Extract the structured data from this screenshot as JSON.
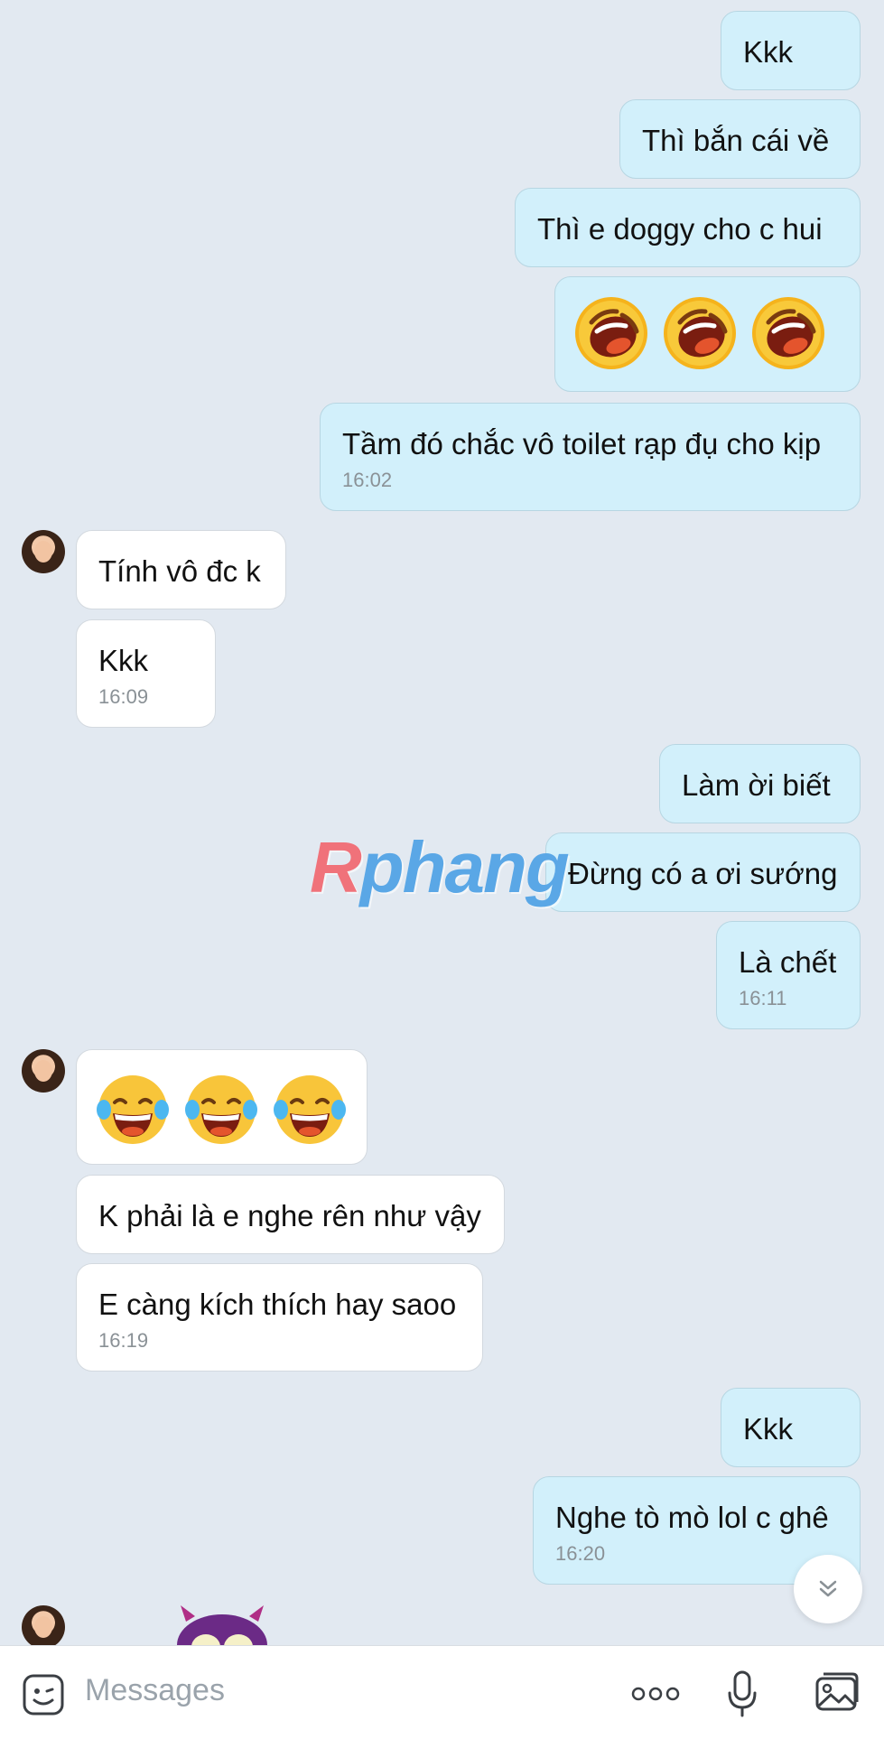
{
  "messages": [
    {
      "dir": "out",
      "text": "Kkk"
    },
    {
      "dir": "out",
      "text": "Thì bắn cái về"
    },
    {
      "dir": "out",
      "text": "Thì e doggy cho c hui"
    },
    {
      "dir": "out",
      "emoji": "laughing-face-icon x3"
    },
    {
      "dir": "out",
      "text": "Tầm đó chắc vô toilet rạp đụ cho kịp",
      "time": "16:02"
    },
    {
      "dir": "in",
      "text": "Tính vô đc k"
    },
    {
      "dir": "in",
      "text": "Kkk",
      "time": "16:09"
    },
    {
      "dir": "out",
      "text": "Làm ời biết"
    },
    {
      "dir": "out",
      "text": "Đừng có a ơi sướng"
    },
    {
      "dir": "out",
      "text": "Là chết",
      "time": "16:11"
    },
    {
      "dir": "in",
      "emoji": "tears-of-joy-icon x3"
    },
    {
      "dir": "in",
      "text": "K phải là e nghe rên như vậy"
    },
    {
      "dir": "in",
      "text": "E càng kích thích hay saoo",
      "time": "16:19"
    },
    {
      "dir": "out",
      "text": "Kkk"
    },
    {
      "dir": "out",
      "text": "Nghe tò mò lol c ghê",
      "time": "16:20"
    }
  ],
  "watermark": "Rphang",
  "input": {
    "placeholder": "Messages"
  },
  "icons": {
    "sticker": "sticker-face-icon",
    "more": "more-dots-icon",
    "mic": "microphone-icon",
    "gallery": "image-gallery-icon",
    "scroll": "chevron-double-down-icon"
  },
  "colors": {
    "outgoing": "#d2f0fb",
    "incoming": "#ffffff",
    "background": "#e2e9f1"
  }
}
